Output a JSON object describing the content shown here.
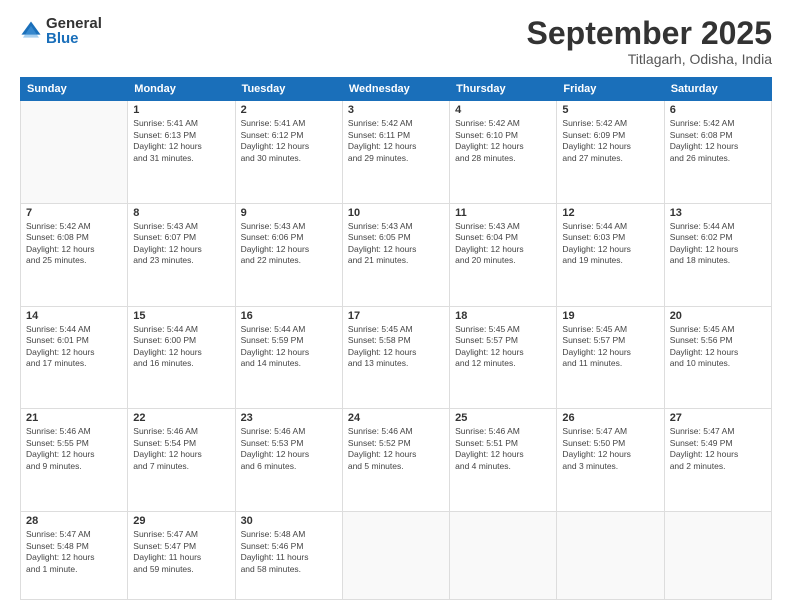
{
  "header": {
    "logo_general": "General",
    "logo_blue": "Blue",
    "month_title": "September 2025",
    "subtitle": "Titlagarh, Odisha, India"
  },
  "columns": [
    "Sunday",
    "Monday",
    "Tuesday",
    "Wednesday",
    "Thursday",
    "Friday",
    "Saturday"
  ],
  "weeks": [
    [
      {
        "day": "",
        "text": ""
      },
      {
        "day": "1",
        "text": "Sunrise: 5:41 AM\nSunset: 6:13 PM\nDaylight: 12 hours\nand 31 minutes."
      },
      {
        "day": "2",
        "text": "Sunrise: 5:41 AM\nSunset: 6:12 PM\nDaylight: 12 hours\nand 30 minutes."
      },
      {
        "day": "3",
        "text": "Sunrise: 5:42 AM\nSunset: 6:11 PM\nDaylight: 12 hours\nand 29 minutes."
      },
      {
        "day": "4",
        "text": "Sunrise: 5:42 AM\nSunset: 6:10 PM\nDaylight: 12 hours\nand 28 minutes."
      },
      {
        "day": "5",
        "text": "Sunrise: 5:42 AM\nSunset: 6:09 PM\nDaylight: 12 hours\nand 27 minutes."
      },
      {
        "day": "6",
        "text": "Sunrise: 5:42 AM\nSunset: 6:08 PM\nDaylight: 12 hours\nand 26 minutes."
      }
    ],
    [
      {
        "day": "7",
        "text": "Sunrise: 5:42 AM\nSunset: 6:08 PM\nDaylight: 12 hours\nand 25 minutes."
      },
      {
        "day": "8",
        "text": "Sunrise: 5:43 AM\nSunset: 6:07 PM\nDaylight: 12 hours\nand 23 minutes."
      },
      {
        "day": "9",
        "text": "Sunrise: 5:43 AM\nSunset: 6:06 PM\nDaylight: 12 hours\nand 22 minutes."
      },
      {
        "day": "10",
        "text": "Sunrise: 5:43 AM\nSunset: 6:05 PM\nDaylight: 12 hours\nand 21 minutes."
      },
      {
        "day": "11",
        "text": "Sunrise: 5:43 AM\nSunset: 6:04 PM\nDaylight: 12 hours\nand 20 minutes."
      },
      {
        "day": "12",
        "text": "Sunrise: 5:44 AM\nSunset: 6:03 PM\nDaylight: 12 hours\nand 19 minutes."
      },
      {
        "day": "13",
        "text": "Sunrise: 5:44 AM\nSunset: 6:02 PM\nDaylight: 12 hours\nand 18 minutes."
      }
    ],
    [
      {
        "day": "14",
        "text": "Sunrise: 5:44 AM\nSunset: 6:01 PM\nDaylight: 12 hours\nand 17 minutes."
      },
      {
        "day": "15",
        "text": "Sunrise: 5:44 AM\nSunset: 6:00 PM\nDaylight: 12 hours\nand 16 minutes."
      },
      {
        "day": "16",
        "text": "Sunrise: 5:44 AM\nSunset: 5:59 PM\nDaylight: 12 hours\nand 14 minutes."
      },
      {
        "day": "17",
        "text": "Sunrise: 5:45 AM\nSunset: 5:58 PM\nDaylight: 12 hours\nand 13 minutes."
      },
      {
        "day": "18",
        "text": "Sunrise: 5:45 AM\nSunset: 5:57 PM\nDaylight: 12 hours\nand 12 minutes."
      },
      {
        "day": "19",
        "text": "Sunrise: 5:45 AM\nSunset: 5:57 PM\nDaylight: 12 hours\nand 11 minutes."
      },
      {
        "day": "20",
        "text": "Sunrise: 5:45 AM\nSunset: 5:56 PM\nDaylight: 12 hours\nand 10 minutes."
      }
    ],
    [
      {
        "day": "21",
        "text": "Sunrise: 5:46 AM\nSunset: 5:55 PM\nDaylight: 12 hours\nand 9 minutes."
      },
      {
        "day": "22",
        "text": "Sunrise: 5:46 AM\nSunset: 5:54 PM\nDaylight: 12 hours\nand 7 minutes."
      },
      {
        "day": "23",
        "text": "Sunrise: 5:46 AM\nSunset: 5:53 PM\nDaylight: 12 hours\nand 6 minutes."
      },
      {
        "day": "24",
        "text": "Sunrise: 5:46 AM\nSunset: 5:52 PM\nDaylight: 12 hours\nand 5 minutes."
      },
      {
        "day": "25",
        "text": "Sunrise: 5:46 AM\nSunset: 5:51 PM\nDaylight: 12 hours\nand 4 minutes."
      },
      {
        "day": "26",
        "text": "Sunrise: 5:47 AM\nSunset: 5:50 PM\nDaylight: 12 hours\nand 3 minutes."
      },
      {
        "day": "27",
        "text": "Sunrise: 5:47 AM\nSunset: 5:49 PM\nDaylight: 12 hours\nand 2 minutes."
      }
    ],
    [
      {
        "day": "28",
        "text": "Sunrise: 5:47 AM\nSunset: 5:48 PM\nDaylight: 12 hours\nand 1 minute."
      },
      {
        "day": "29",
        "text": "Sunrise: 5:47 AM\nSunset: 5:47 PM\nDaylight: 11 hours\nand 59 minutes."
      },
      {
        "day": "30",
        "text": "Sunrise: 5:48 AM\nSunset: 5:46 PM\nDaylight: 11 hours\nand 58 minutes."
      },
      {
        "day": "",
        "text": ""
      },
      {
        "day": "",
        "text": ""
      },
      {
        "day": "",
        "text": ""
      },
      {
        "day": "",
        "text": ""
      }
    ]
  ]
}
